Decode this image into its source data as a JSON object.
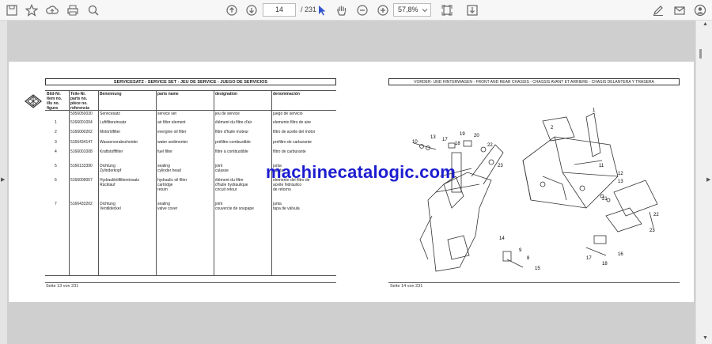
{
  "toolbar": {
    "icons": [
      "save-icon",
      "bookmark-star-icon",
      "upload-icon",
      "print-icon",
      "zoom-search-icon",
      "page-up-icon",
      "page-down-icon",
      "select-cursor-icon",
      "hand-pan-icon",
      "zoom-out-icon",
      "zoom-in-icon",
      "zoom-dropdown-icon",
      "fit-page-icon",
      "export-icon",
      "sign-icon",
      "email-icon",
      "account-icon"
    ],
    "page_current": "14",
    "page_total": "/ 231",
    "zoom_level": "57,8%"
  },
  "left_page": {
    "title": "SERVICESATZ - SERVICE SET - JEU DE SERVICE - JUEGO DE SERVICIOS",
    "columns": [
      "Bild-Nr.\nitem no.\nillu no.\nfigura",
      "Teile-Nr.\nparts no.\npièce no.\nreferencia",
      "Benennung",
      "parts name",
      "designation",
      "denominación"
    ],
    "rows": [
      {
        "item": "",
        "part": "5056050030",
        "de": "Servicesatz",
        "en": "service set",
        "fr": "jeu de service",
        "es": "juego de servicio"
      },
      {
        "item": "1",
        "part": "5166001004",
        "de": "Luftfiltereinsatz",
        "en": "air filter element",
        "fr": "élément du filtre d'air",
        "es": "elemento filtro de aire"
      },
      {
        "item": "2",
        "part": "5166000202",
        "de": "Motorölfilter",
        "en": "evergine oil filter",
        "fr": "filtre d'huile moteur",
        "es": "filtro de aceite del motor"
      },
      {
        "item": "3",
        "part": "5166434147",
        "de": "Wasservorabscheider",
        "en": "water sedimenter",
        "fr": "préfiltre combustible",
        "es": "prefiltro de carburante"
      },
      {
        "item": "4",
        "part": "5166001008",
        "de": "Kraftstofffilter",
        "en": "fuel filter",
        "fr": "filtre à combustible",
        "es": "filtro de carburante"
      },
      {
        "item": "5",
        "part": "5166133390",
        "de": "Dichtung\nZylinderkopf",
        "en": "sealing\ncylinder head",
        "fr": "joint\nculasse",
        "es": "junta\nculata"
      },
      {
        "item": "6",
        "part": "5166009057",
        "de": "Hydrauliköl­filtereinsatz\nRücklauf",
        "en": "hydraulic oil filter\ncartridge\nreturn",
        "fr": "élément du filtre\nd'huile hydraulique\ncircuit retour",
        "es": "elemento del filtro de\naceite hidráulico\nde retorno"
      },
      {
        "item": "7",
        "part": "5166433202",
        "de": "Dichtung\nVentildeckel",
        "en": "sealing\nvalve cover",
        "fr": "joint\ncouvercle de soupape",
        "es": "junta\ntapa de válvula"
      }
    ],
    "footer": "Seite 13 von 231"
  },
  "right_page": {
    "title": "VORDER- UND HINTERWAGEN - FRONT AND REAR CHASSIS - CHASSIS AVANT ET ARRIERE - CHASIS DELANTERA Y TRASERA",
    "labels": [
      "10",
      "13",
      "17",
      "18",
      "19",
      "20",
      "22",
      "23",
      "2",
      "1",
      "11",
      "12",
      "13",
      "14",
      "15",
      "16",
      "17",
      "18",
      "21",
      "22",
      "23",
      "9",
      "8"
    ],
    "footer": "Seite 14 von 231"
  },
  "watermark": "machinecatalogic.com"
}
